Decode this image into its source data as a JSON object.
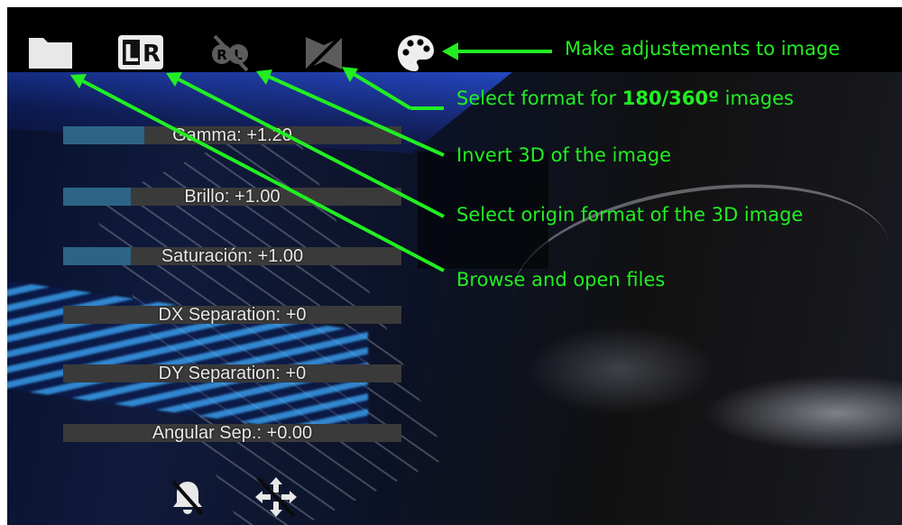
{
  "toolbar": {
    "icons": [
      "folder-icon",
      "lr-format-icon",
      "invert-3d-icon",
      "format-360-icon",
      "palette-icon"
    ],
    "lr_left": "L",
    "lr_right": "R",
    "rl_left": "R",
    "rl_right": "L"
  },
  "sliders": [
    {
      "label": "Gamma: +1.20",
      "fill": 0.24
    },
    {
      "label": "Brillo: +1.00",
      "fill": 0.2
    },
    {
      "label": "Saturación: +1.00",
      "fill": 0.2
    },
    {
      "label": "DX Separation: +0",
      "fill": 0.0
    },
    {
      "label": "DY Separation: +0",
      "fill": 0.0
    },
    {
      "label": "Angular Sep.: +0.00",
      "fill": 0.0
    }
  ],
  "bottom_icons": [
    "notifications-off-icon",
    "move-arrows-icon"
  ],
  "annotations": {
    "adjust": "Make adjustements to image",
    "format_pre": "Select format for ",
    "format_bold": "180/360º",
    "format_post": " images",
    "invert": "Invert 3D of the image",
    "origin": "Select origin format of the 3D image",
    "browse": "Browse and open files"
  },
  "colors": {
    "annotation": "#22ee22",
    "slider_fill": "#2d6485",
    "slider_track": "#3a3a3a"
  }
}
